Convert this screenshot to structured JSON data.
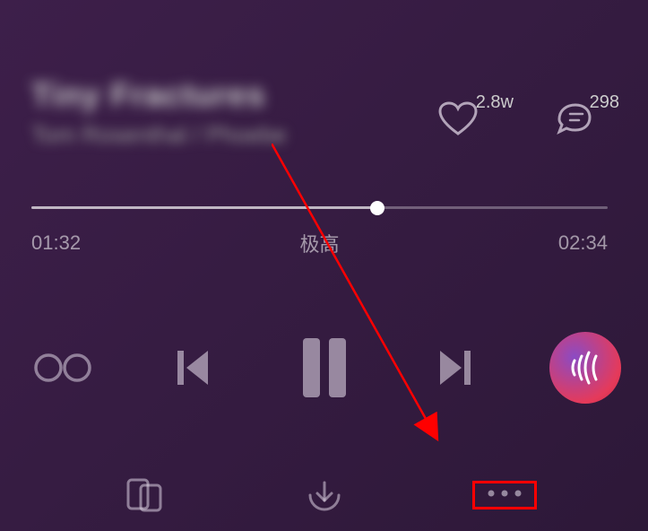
{
  "song": {
    "title": "Tiny Fractures",
    "artist": "Tom Rosenthal / Phoebe"
  },
  "stats": {
    "likes": "2.8w",
    "comments": "298"
  },
  "progress": {
    "current_time": "01:32",
    "total_time": "02:34",
    "quality": "极高"
  }
}
